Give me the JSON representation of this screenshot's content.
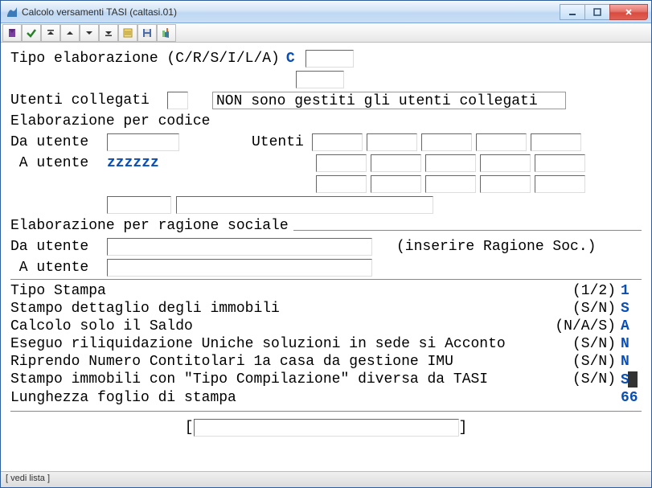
{
  "window": {
    "title": "Calcolo versamenti TASI (caltasi.01)"
  },
  "form": {
    "tipo_elab_label": "Tipo elaborazione (C/R/S/I/L/A)",
    "tipo_elab_value": "C",
    "utenti_collegati_label": "Utenti collegati",
    "non_gestiti": "NON sono gestiti gli utenti collegati",
    "elab_codice": "Elaborazione per codice",
    "da_utente": "Da utente",
    "a_utente": " A utente",
    "a_utente_val": "zzzzzz",
    "utenti_label": "Utenti",
    "elab_ragione": "Elaborazione per ragione sociale",
    "hint_ragione": "(inserire Ragione Soc.)",
    "options": [
      {
        "label": "Tipo Stampa",
        "hint": "(1/2)",
        "value": "1"
      },
      {
        "label": "Stampo dettaglio degli immobili",
        "hint": "(S/N)",
        "value": "S"
      },
      {
        "label": "Calcolo solo il Saldo",
        "hint": "(N/A/S)",
        "value": "A"
      },
      {
        "label": "Eseguo riliquidazione Uniche soluzioni in sede si Acconto",
        "hint": "(S/N)",
        "value": "N"
      },
      {
        "label": "Riprendo Numero Contitolari 1a casa da gestione IMU",
        "hint": "(S/N)",
        "value": "N"
      },
      {
        "label": "Stampo immobili con \"Tipo Compilazione\" diversa da TASI",
        "hint": "(S/N)",
        "value": "S"
      },
      {
        "label": "Lunghezza foglio di stampa",
        "hint": "",
        "value": "66"
      }
    ]
  },
  "status": "[ vedi lista ]"
}
